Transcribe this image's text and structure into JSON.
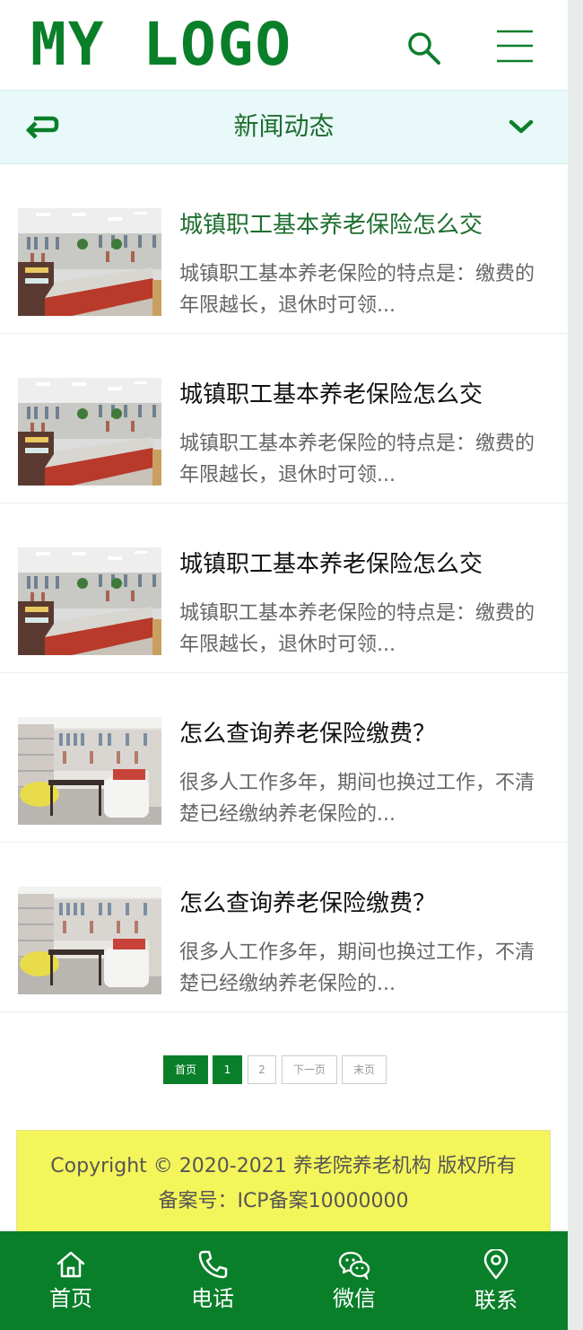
{
  "header": {
    "logo_text": "MY LOGO",
    "icons": {
      "search": "search-icon",
      "menu": "menu-icon"
    }
  },
  "subbar": {
    "title": "新闻动态",
    "icons": {
      "back": "return-arrow-icon",
      "dropdown": "chevron-down-icon"
    }
  },
  "news": [
    {
      "title": "城镇职工基本养老保险怎么交",
      "summary": "城镇职工基本养老保险的特点是：缴费的年限越长，退休时可领...",
      "image": "library-photo-a",
      "active": true
    },
    {
      "title": "城镇职工基本养老保险怎么交",
      "summary": "城镇职工基本养老保险的特点是：缴费的年限越长，退休时可领...",
      "image": "library-photo-a",
      "active": false
    },
    {
      "title": "城镇职工基本养老保险怎么交",
      "summary": "城镇职工基本养老保险的特点是：缴费的年限越长，退休时可领...",
      "image": "library-photo-a",
      "active": false
    },
    {
      "title": "怎么查询养老保险缴费？",
      "summary": "很多人工作多年，期间也换过工作，不清楚已经缴纳养老保险的...",
      "image": "library-photo-b",
      "active": false
    },
    {
      "title": "怎么查询养老保险缴费？",
      "summary": "很多人工作多年，期间也换过工作，不清楚已经缴纳养老保险的...",
      "image": "library-photo-b",
      "active": false
    }
  ],
  "pagination": {
    "first": "首页",
    "pages": [
      "1",
      "2"
    ],
    "current": "1",
    "next": "下一页",
    "last": "末页"
  },
  "footer": {
    "copyright": "Copyright © 2020-2021 养老院养老机构 版权所有",
    "icp": "备案号：ICP备案10000000"
  },
  "bottom_nav": [
    {
      "label": "首页",
      "icon": "home-icon"
    },
    {
      "label": "电话",
      "icon": "phone-icon"
    },
    {
      "label": "微信",
      "icon": "wechat-icon"
    },
    {
      "label": "联系",
      "icon": "location-icon"
    }
  ],
  "colors": {
    "brand_green": "#0a7f2a",
    "title_green": "#1e6e2f",
    "subbar_bg": "#e9f8f9",
    "footer_bg": "#f4f55a"
  }
}
